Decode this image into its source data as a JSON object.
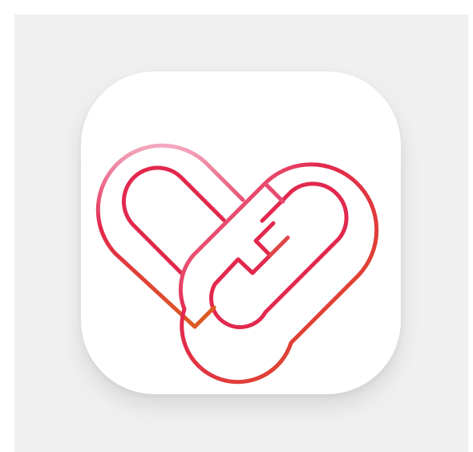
{
  "app_icon": {
    "logo": "interlocking-chain-heart-icon",
    "colors": {
      "pink": "#f19fb8",
      "crimson": "#e3284e",
      "orange": "#dd5520",
      "icon_background": "#ffffff",
      "page_background": "#f0f0f0"
    }
  }
}
